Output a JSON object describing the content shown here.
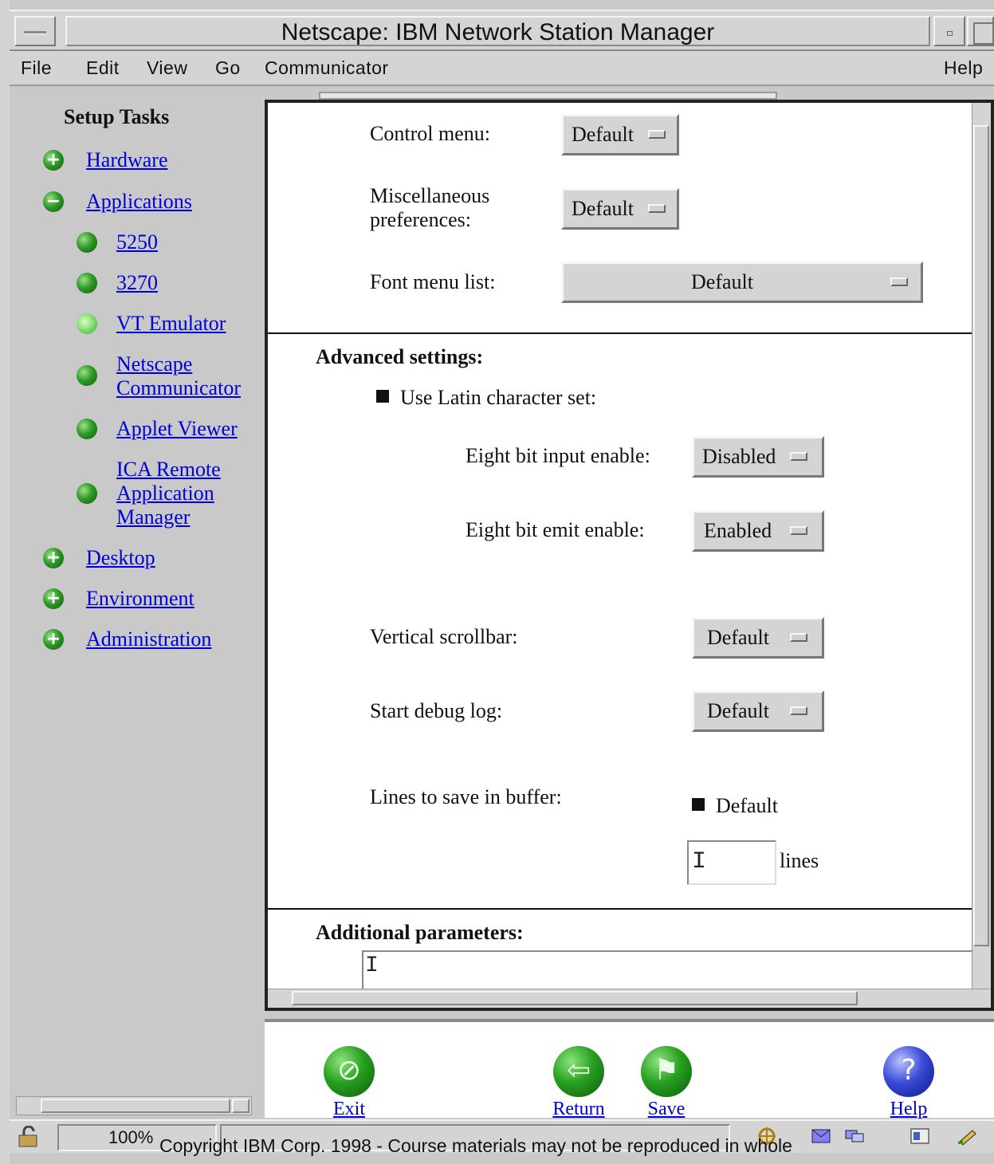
{
  "window": {
    "title": "Netscape: IBM Network Station Manager"
  },
  "menubar": {
    "file": "File",
    "edit": "Edit",
    "view": "View",
    "go": "Go",
    "communicator": "Communicator",
    "help": "Help"
  },
  "sidebar": {
    "heading": "Setup Tasks",
    "items": [
      {
        "label": "Hardware",
        "state": "collapsed"
      },
      {
        "label": "Applications",
        "state": "expanded"
      },
      {
        "label": "5250"
      },
      {
        "label": "3270"
      },
      {
        "label": "VT Emulator",
        "state": "selected"
      },
      {
        "label_line1": "Netscape",
        "label_line2": "Communicator"
      },
      {
        "label": "Applet Viewer"
      },
      {
        "label_line1": "ICA Remote",
        "label_line2": "Application",
        "label_line3": "Manager"
      },
      {
        "label": "Desktop",
        "state": "collapsed"
      },
      {
        "label": "Environment",
        "state": "collapsed"
      },
      {
        "label": "Administration",
        "state": "collapsed"
      }
    ]
  },
  "form": {
    "control_menu": {
      "label": "Control menu:",
      "value": "Default"
    },
    "misc_prefs": {
      "label_line1": "Miscellaneous",
      "label_line2": "preferences:",
      "value": "Default"
    },
    "font_menu_list": {
      "label": "Font menu list:",
      "value": "Default"
    },
    "advanced": {
      "title": "Advanced settings:",
      "use_latin": {
        "label": "Use Latin character set:",
        "checked": true
      },
      "eight_bit_input": {
        "label": "Eight bit input enable:",
        "value": "Disabled"
      },
      "eight_bit_emit": {
        "label": "Eight bit emit enable:",
        "value": "Enabled"
      },
      "vertical_scrollbar": {
        "label": "Vertical scrollbar:",
        "value": "Default"
      },
      "start_debug_log": {
        "label": "Start debug log:",
        "value": "Default"
      },
      "lines_buffer": {
        "label": "Lines to save in buffer:",
        "default_label": "Default",
        "default_checked": true,
        "value": "",
        "unit": "lines"
      }
    },
    "additional": {
      "title": "Additional parameters:",
      "value": ""
    }
  },
  "buttons": {
    "exit": "Exit",
    "return": "Return",
    "save": "Save",
    "help": "Help"
  },
  "statusbar": {
    "zoom": "100%",
    "copyright": "Copyright IBM Corp. 1998 - Course materials may not be reproduced in whole"
  },
  "colors": {
    "link": "#0000d8",
    "chrome": "#d4d4d4",
    "nav_ball": "#2f9a27",
    "help_ball": "#3a4bd8"
  }
}
